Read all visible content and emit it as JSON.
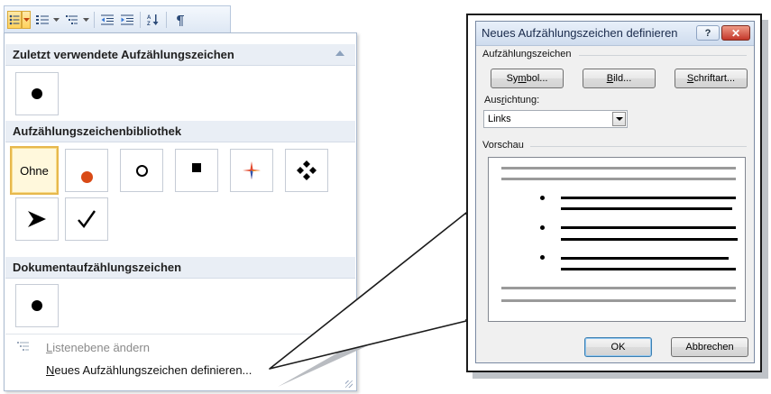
{
  "gallery": {
    "recent_header": "Zuletzt verwendete Aufzählungszeichen",
    "library_header": "Aufzählungszeichenbibliothek",
    "library_none_label": "Ohne",
    "document_header": "Dokumentaufzählungszeichen",
    "change_level": "Listenebene ändern",
    "define_new": "Neues Aufzählungszeichen definieren...",
    "bullet_colors": {
      "red_dot": "#d94a16",
      "selected_border": "#e7b84d"
    }
  },
  "toolbar": {
    "icons": [
      "bullets-icon",
      "dropdown-arrow-icon",
      "numbering-icon",
      "multilevel-list-icon",
      "decrease-indent-icon",
      "increase-indent-icon",
      "sort-icon",
      "pilcrow-icon"
    ]
  },
  "dialog": {
    "title": "Neues Aufzählungszeichen definieren",
    "help_glyph": "?",
    "close_glyph": "✕",
    "group_bullet": "Aufzählungszeichen",
    "btn_symbol": {
      "pre": "Sy",
      "key": "m",
      "post": "bol..."
    },
    "btn_picture": {
      "pre": "",
      "key": "B",
      "post": "ild..."
    },
    "btn_font": {
      "pre": "",
      "key": "S",
      "post": "chriftart..."
    },
    "alignment_label": {
      "pre": "Aus",
      "key": "r",
      "post": "ichtung:"
    },
    "alignment_value": "Links",
    "group_preview": "Vorschau",
    "ok": "OK",
    "cancel": "Abbrechen"
  }
}
